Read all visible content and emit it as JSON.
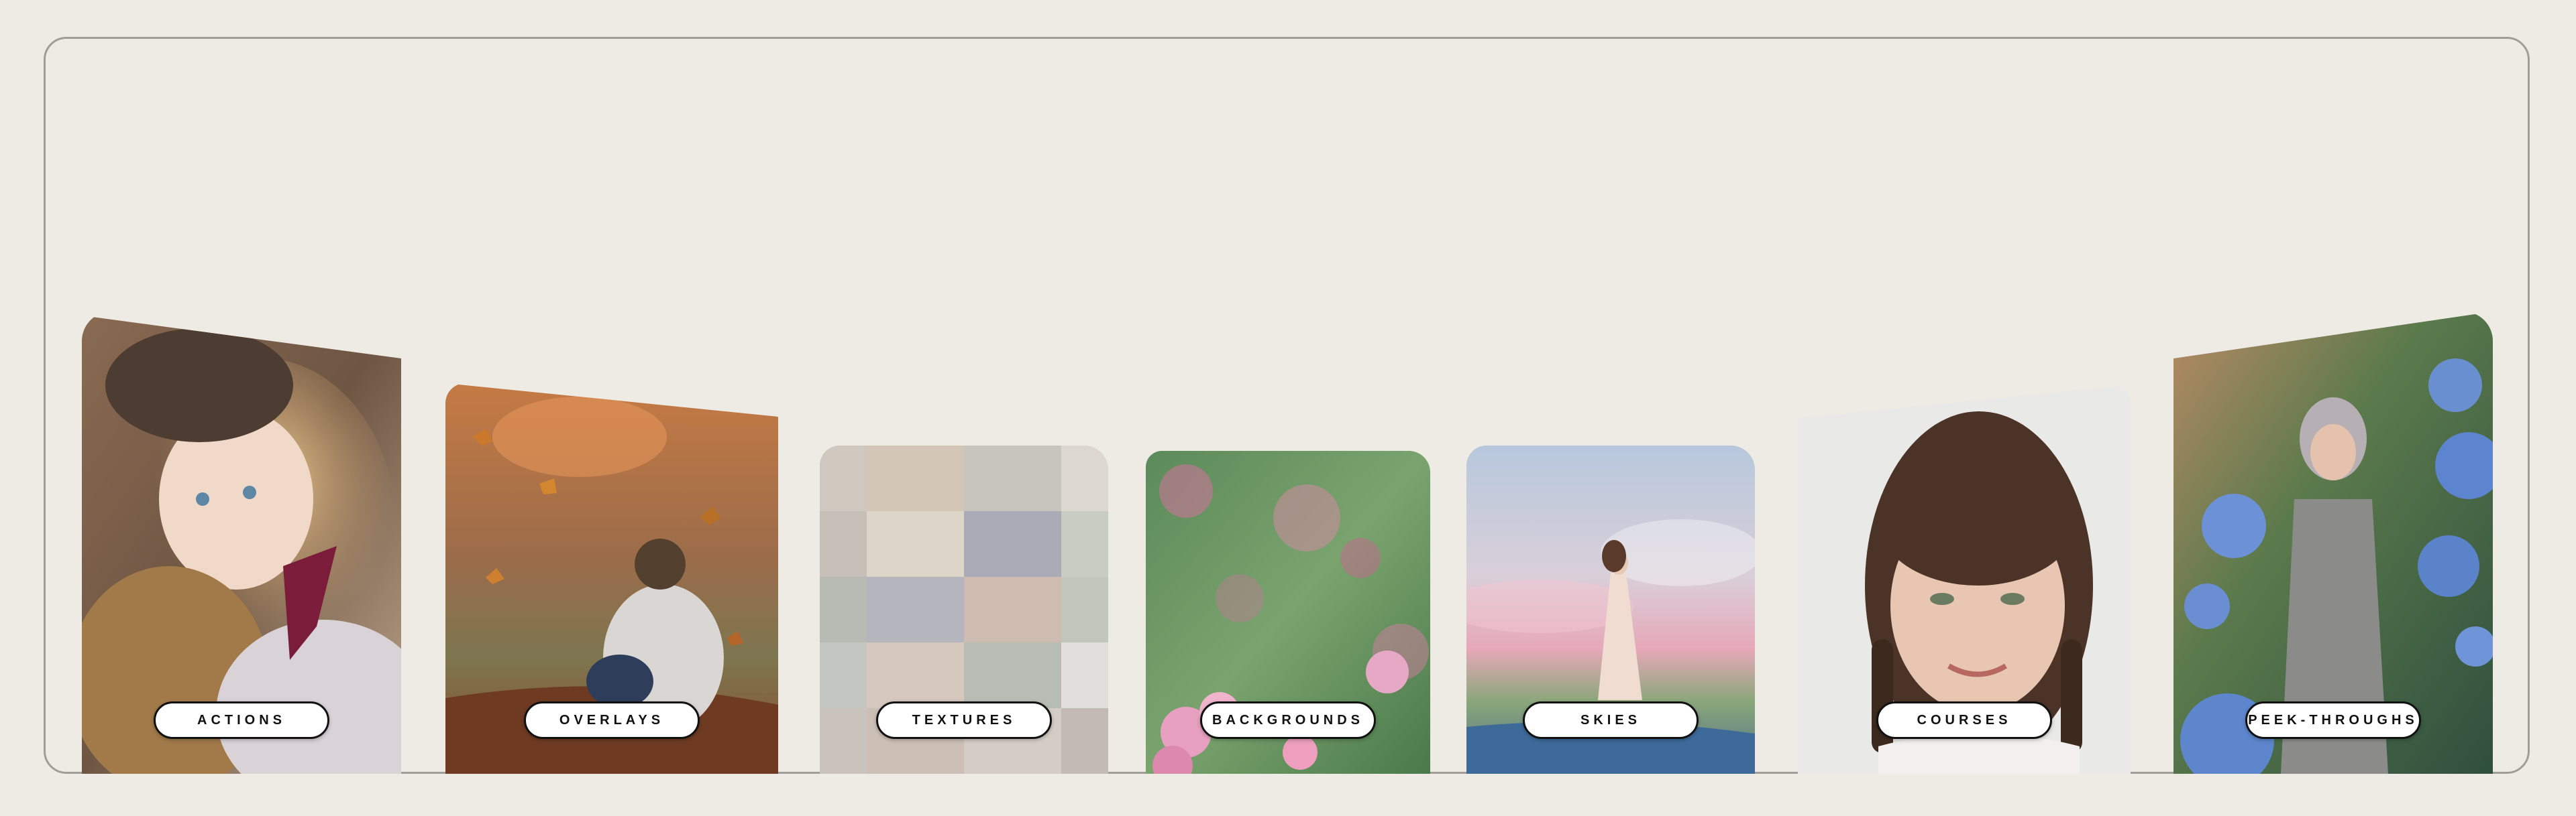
{
  "page": {
    "background": "#eeebe5",
    "frame_border": "#a09d98"
  },
  "categories": [
    {
      "label": "ACTIONS",
      "image": "girl with teddy bear and beret"
    },
    {
      "label": "OVERLAYS",
      "image": "boy sitting in falling autumn leaves"
    },
    {
      "label": "TEXTURES",
      "image": "grid of painted texture swatches"
    },
    {
      "label": "BACKGROUNDS",
      "image": "pink roses on green bokeh"
    },
    {
      "label": "SKIES",
      "image": "girl in white dress under pastel sky"
    },
    {
      "label": "COURSES",
      "image": "smiling girl with braids portrait"
    },
    {
      "label": "PEEK-THROUGHS",
      "image": "girl in bonnet among blue hydrangeas"
    }
  ],
  "colors": {
    "pill_background": "#ffffff",
    "pill_border": "#111111",
    "pill_text": "#111111"
  }
}
